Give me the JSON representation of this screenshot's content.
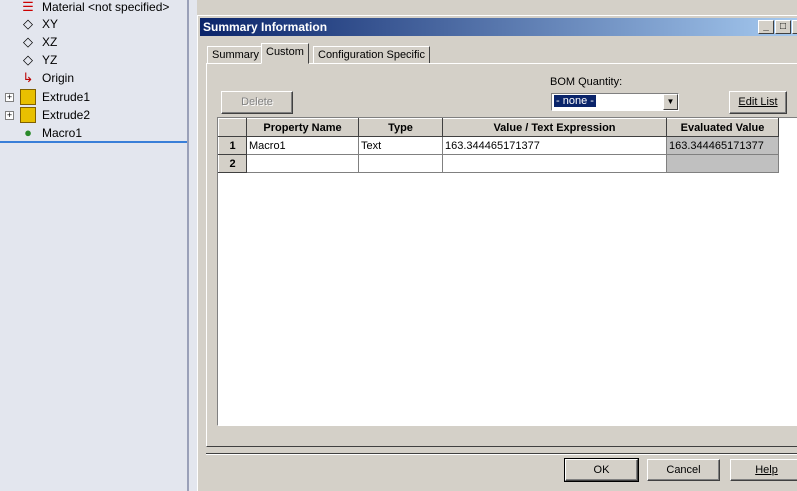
{
  "tree": {
    "items": [
      {
        "label": "Material <not specified>",
        "icon": "material-icon"
      },
      {
        "label": "XY",
        "icon": "plane-icon"
      },
      {
        "label": "XZ",
        "icon": "plane-icon"
      },
      {
        "label": "YZ",
        "icon": "plane-icon"
      },
      {
        "label": "Origin",
        "icon": "origin-icon"
      },
      {
        "label": "Extrude1",
        "icon": "extrude-icon",
        "expandable": true
      },
      {
        "label": "Extrude2",
        "icon": "extrude-icon",
        "expandable": true
      },
      {
        "label": "Macro1",
        "icon": "macro-icon"
      }
    ]
  },
  "dialog": {
    "title": "Summary Information",
    "tabs": [
      "Summary",
      "Custom",
      "Configuration Specific"
    ],
    "active_tab": "Custom",
    "bom_label": "BOM Quantity:",
    "bom_value": "- none -",
    "delete_label": "Delete",
    "edit_list_label": "Edit List",
    "columns": [
      "Property Name",
      "Type",
      "Value / Text Expression",
      "Evaluated Value"
    ],
    "rows": [
      {
        "num": "1",
        "name": "Macro1",
        "type": "Text",
        "value": "163.344465171377",
        "evaluated": "163.344465171377"
      },
      {
        "num": "2",
        "name": "",
        "type": "",
        "value": "",
        "evaluated": ""
      }
    ],
    "ok_label": "OK",
    "cancel_label": "Cancel",
    "help_label": "Help"
  }
}
